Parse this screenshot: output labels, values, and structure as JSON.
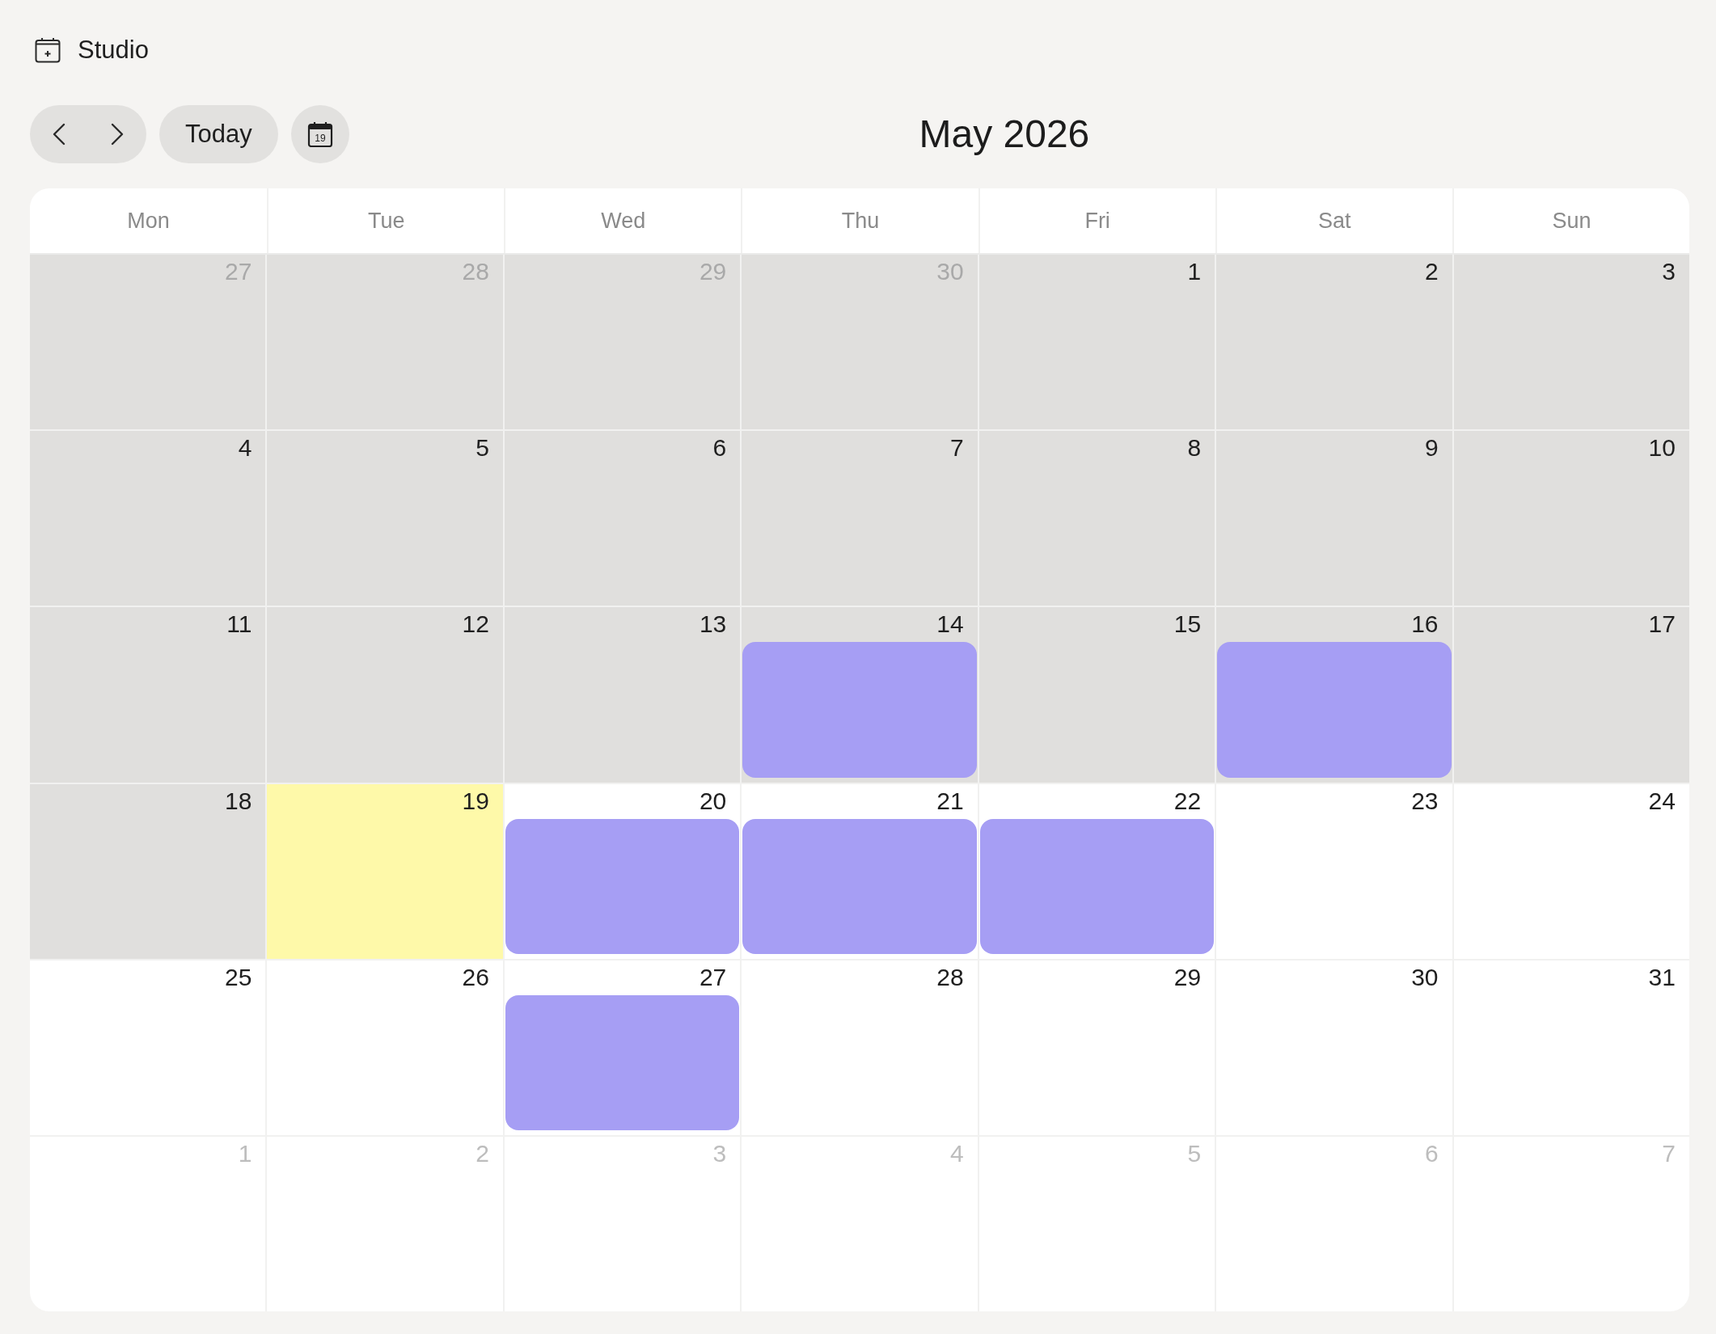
{
  "app": {
    "title": "Studio"
  },
  "toolbar": {
    "today_button": "Today",
    "date_button_day": "19",
    "month_title": "May 2026"
  },
  "calendar": {
    "weekdays": [
      "Mon",
      "Tue",
      "Wed",
      "Thu",
      "Fri",
      "Sat",
      "Sun"
    ],
    "weeks": [
      {
        "days": [
          {
            "date": "27",
            "outside_month": true,
            "past": true,
            "today": false,
            "event": false
          },
          {
            "date": "28",
            "outside_month": true,
            "past": true,
            "today": false,
            "event": false
          },
          {
            "date": "29",
            "outside_month": true,
            "past": true,
            "today": false,
            "event": false
          },
          {
            "date": "30",
            "outside_month": true,
            "past": true,
            "today": false,
            "event": false
          },
          {
            "date": "1",
            "outside_month": false,
            "past": true,
            "today": false,
            "event": false
          },
          {
            "date": "2",
            "outside_month": false,
            "past": true,
            "today": false,
            "event": false
          },
          {
            "date": "3",
            "outside_month": false,
            "past": true,
            "today": false,
            "event": false
          }
        ]
      },
      {
        "days": [
          {
            "date": "4",
            "outside_month": false,
            "past": true,
            "today": false,
            "event": false
          },
          {
            "date": "5",
            "outside_month": false,
            "past": true,
            "today": false,
            "event": false
          },
          {
            "date": "6",
            "outside_month": false,
            "past": true,
            "today": false,
            "event": false
          },
          {
            "date": "7",
            "outside_month": false,
            "past": true,
            "today": false,
            "event": false
          },
          {
            "date": "8",
            "outside_month": false,
            "past": true,
            "today": false,
            "event": false
          },
          {
            "date": "9",
            "outside_month": false,
            "past": true,
            "today": false,
            "event": false
          },
          {
            "date": "10",
            "outside_month": false,
            "past": true,
            "today": false,
            "event": false
          }
        ]
      },
      {
        "days": [
          {
            "date": "11",
            "outside_month": false,
            "past": true,
            "today": false,
            "event": false
          },
          {
            "date": "12",
            "outside_month": false,
            "past": true,
            "today": false,
            "event": false
          },
          {
            "date": "13",
            "outside_month": false,
            "past": true,
            "today": false,
            "event": false
          },
          {
            "date": "14",
            "outside_month": false,
            "past": true,
            "today": false,
            "event": true
          },
          {
            "date": "15",
            "outside_month": false,
            "past": true,
            "today": false,
            "event": false
          },
          {
            "date": "16",
            "outside_month": false,
            "past": true,
            "today": false,
            "event": true
          },
          {
            "date": "17",
            "outside_month": false,
            "past": true,
            "today": false,
            "event": false
          }
        ]
      },
      {
        "days": [
          {
            "date": "18",
            "outside_month": false,
            "past": true,
            "today": false,
            "event": false
          },
          {
            "date": "19",
            "outside_month": false,
            "past": false,
            "today": true,
            "event": false
          },
          {
            "date": "20",
            "outside_month": false,
            "past": false,
            "today": false,
            "event": true
          },
          {
            "date": "21",
            "outside_month": false,
            "past": false,
            "today": false,
            "event": true
          },
          {
            "date": "22",
            "outside_month": false,
            "past": false,
            "today": false,
            "event": true
          },
          {
            "date": "23",
            "outside_month": false,
            "past": false,
            "today": false,
            "event": false
          },
          {
            "date": "24",
            "outside_month": false,
            "past": false,
            "today": false,
            "event": false
          }
        ]
      },
      {
        "days": [
          {
            "date": "25",
            "outside_month": false,
            "past": false,
            "today": false,
            "event": false
          },
          {
            "date": "26",
            "outside_month": false,
            "past": false,
            "today": false,
            "event": false
          },
          {
            "date": "27",
            "outside_month": false,
            "past": false,
            "today": false,
            "event": true
          },
          {
            "date": "28",
            "outside_month": false,
            "past": false,
            "today": false,
            "event": false
          },
          {
            "date": "29",
            "outside_month": false,
            "past": false,
            "today": false,
            "event": false
          },
          {
            "date": "30",
            "outside_month": false,
            "past": false,
            "today": false,
            "event": false
          },
          {
            "date": "31",
            "outside_month": false,
            "past": false,
            "today": false,
            "event": false
          }
        ]
      },
      {
        "days": [
          {
            "date": "1",
            "outside_month": true,
            "past": false,
            "today": false,
            "event": false
          },
          {
            "date": "2",
            "outside_month": true,
            "past": false,
            "today": false,
            "event": false
          },
          {
            "date": "3",
            "outside_month": true,
            "past": false,
            "today": false,
            "event": false
          },
          {
            "date": "4",
            "outside_month": true,
            "past": false,
            "today": false,
            "event": false
          },
          {
            "date": "5",
            "outside_month": true,
            "past": false,
            "today": false,
            "event": false
          },
          {
            "date": "6",
            "outside_month": true,
            "past": false,
            "today": false,
            "event": false
          },
          {
            "date": "7",
            "outside_month": true,
            "past": false,
            "today": false,
            "event": false
          }
        ]
      }
    ]
  }
}
